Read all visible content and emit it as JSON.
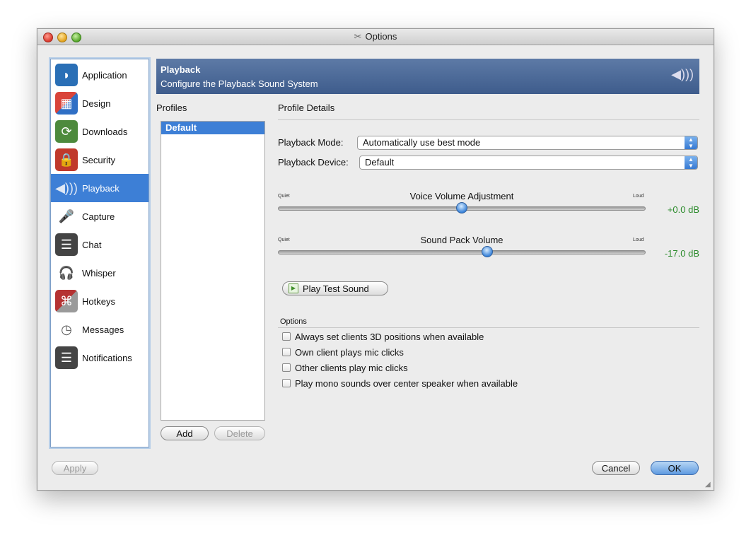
{
  "window": {
    "title": "Options"
  },
  "sidebar": {
    "items": [
      {
        "label": "Application",
        "icon": "application-icon",
        "color": "#2a6fb6"
      },
      {
        "label": "Design",
        "icon": "design-icon",
        "color": "#c8432f"
      },
      {
        "label": "Downloads",
        "icon": "downloads-icon",
        "color": "#4d8a3d"
      },
      {
        "label": "Security",
        "icon": "security-icon",
        "color": "#c0392b"
      },
      {
        "label": "Playback",
        "icon": "playback-icon",
        "color": "#6b7b8c",
        "selected": true
      },
      {
        "label": "Capture",
        "icon": "microphone-icon",
        "color": "#555555"
      },
      {
        "label": "Chat",
        "icon": "chat-icon",
        "color": "#444444"
      },
      {
        "label": "Whisper",
        "icon": "headset-icon",
        "color": "#444444"
      },
      {
        "label": "Hotkeys",
        "icon": "hotkeys-icon",
        "color": "#b53232"
      },
      {
        "label": "Messages",
        "icon": "messages-icon",
        "color": "#666666"
      },
      {
        "label": "Notifications",
        "icon": "notifications-icon",
        "color": "#444444"
      }
    ]
  },
  "header": {
    "title": "Playback",
    "subtitle": "Configure the Playback Sound System"
  },
  "profiles": {
    "heading": "Profiles",
    "items": [
      "Default"
    ],
    "add_label": "Add",
    "delete_label": "Delete"
  },
  "details": {
    "heading": "Profile Details",
    "mode_label": "Playback Mode:",
    "mode_value": "Automatically use best mode",
    "device_label": "Playback Device:",
    "device_value": "Default"
  },
  "voice_slider": {
    "title": "Voice Volume Adjustment",
    "min_label": "Quiet",
    "max_label": "Loud",
    "value_text": "+0.0 dB",
    "position_fraction": 0.5
  },
  "sound_pack_slider": {
    "title": "Sound Pack Volume",
    "min_label": "Quiet",
    "max_label": "Loud",
    "value_text": "-17.0 dB",
    "position_fraction": 0.57
  },
  "test_sound": {
    "label": "Play Test Sound"
  },
  "options": {
    "heading": "Options",
    "checkboxes": [
      {
        "label": "Always set clients 3D positions when available",
        "checked": false
      },
      {
        "label": "Own client plays mic clicks",
        "checked": false
      },
      {
        "label": "Other clients play mic clicks",
        "checked": false
      },
      {
        "label": "Play mono sounds over center speaker when available",
        "checked": false
      }
    ]
  },
  "footer": {
    "apply_label": "Apply",
    "cancel_label": "Cancel",
    "ok_label": "OK"
  },
  "colors": {
    "selection": "#3d7fd6",
    "banner": "#4a6896",
    "db_text": "#2a8a2a"
  }
}
